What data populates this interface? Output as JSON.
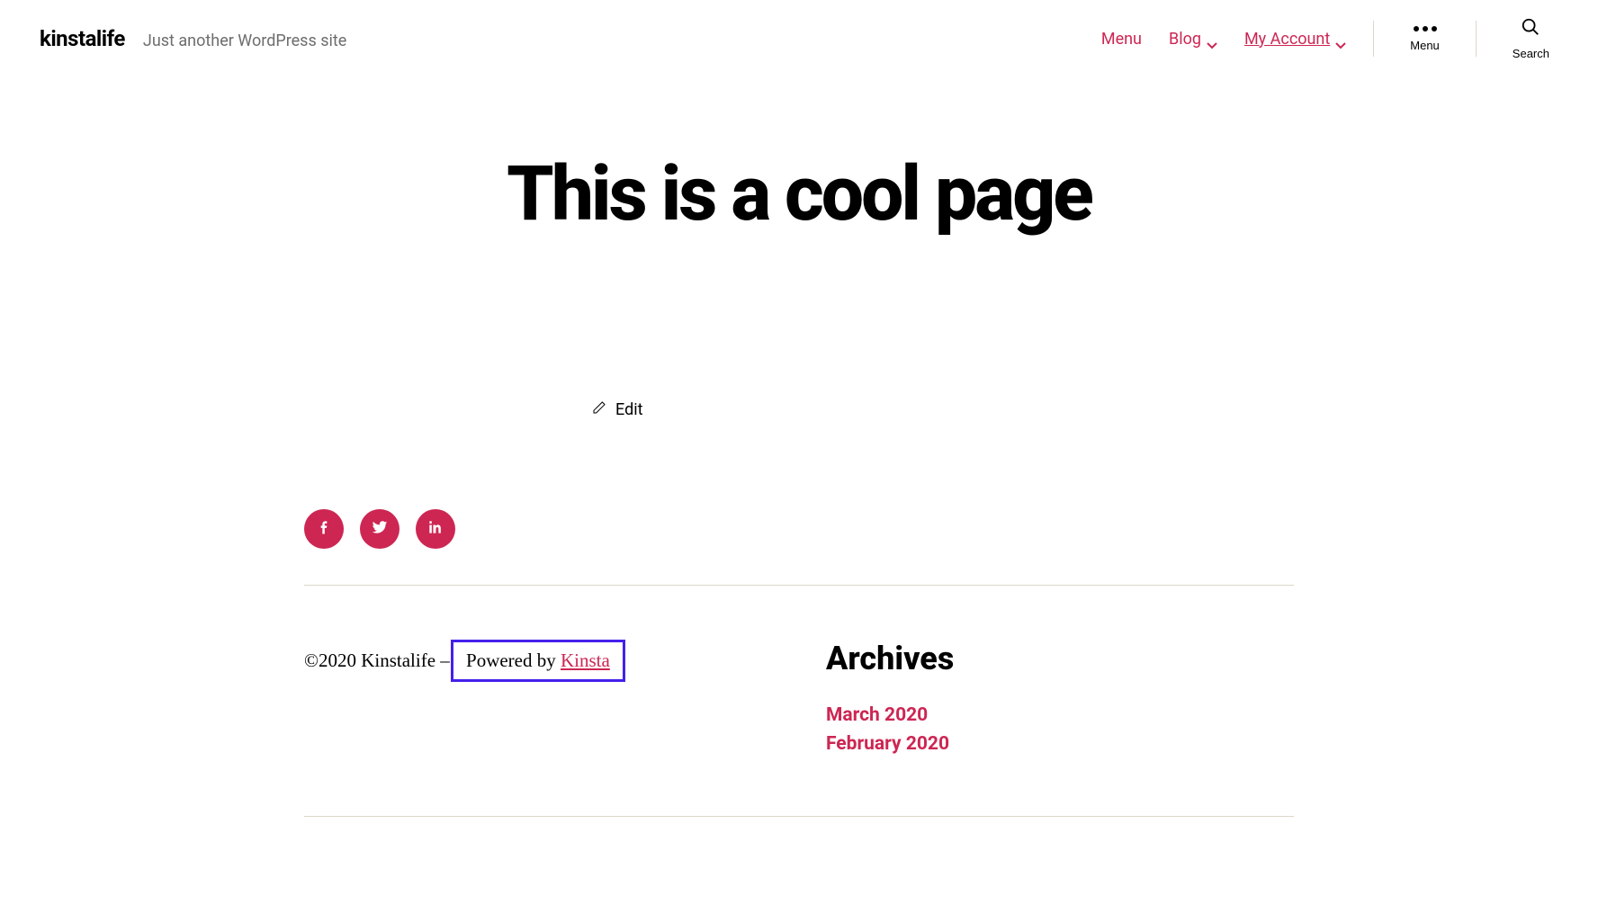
{
  "header": {
    "site_title": "kinstalife",
    "tagline": "Just another WordPress site",
    "nav": [
      {
        "label": "Menu",
        "has_dropdown": false,
        "underlined": false
      },
      {
        "label": "Blog",
        "has_dropdown": true,
        "underlined": false
      },
      {
        "label": "My Account",
        "has_dropdown": true,
        "underlined": true
      }
    ],
    "menu_button_label": "Menu",
    "search_button_label": "Search"
  },
  "page": {
    "title": "This is a cool page",
    "edit_label": "Edit"
  },
  "social": {
    "icons": [
      "facebook",
      "twitter",
      "linkedin"
    ]
  },
  "footer": {
    "copyright_prefix": "©2020 Kinstalife – ",
    "powered_by_text": "Powered by ",
    "powered_by_link": "Kinsta",
    "archives": {
      "title": "Archives",
      "items": [
        "March 2020",
        "February 2020"
      ]
    }
  }
}
